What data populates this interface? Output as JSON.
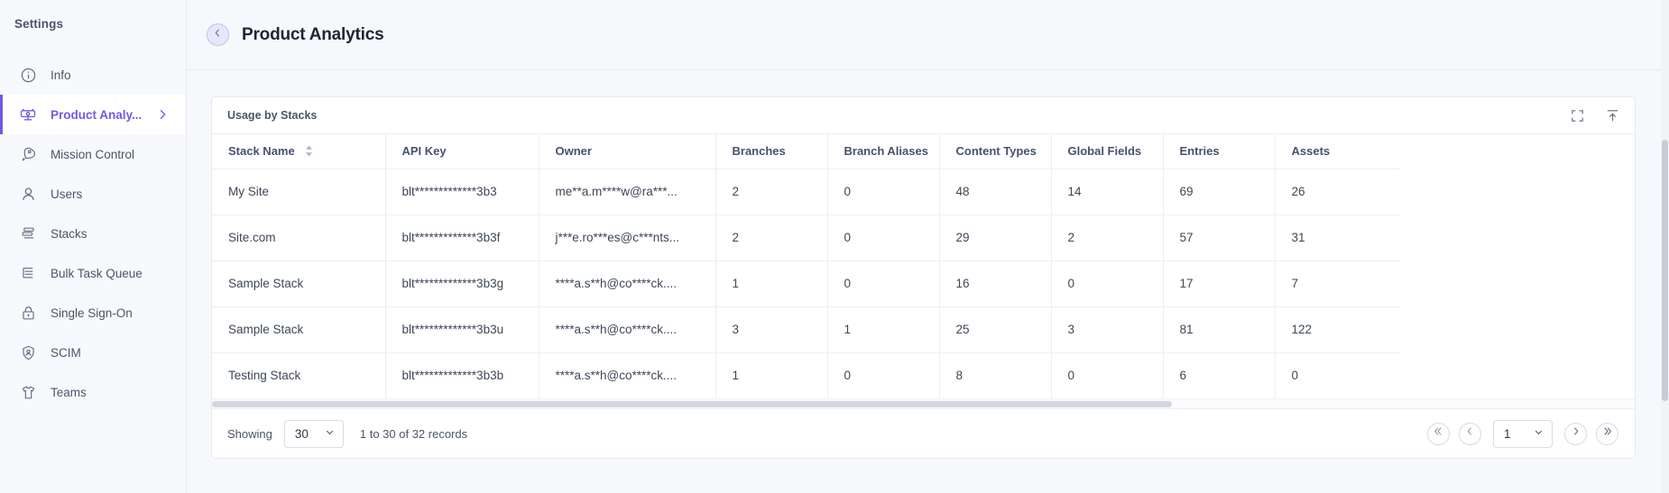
{
  "sidebar": {
    "title": "Settings",
    "items": [
      {
        "label": "Info",
        "icon": "info-circle-icon",
        "active": false
      },
      {
        "label": "Product Analy...",
        "icon": "product-analytics-icon",
        "active": true
      },
      {
        "label": "Mission Control",
        "icon": "rocket-icon",
        "active": false
      },
      {
        "label": "Users",
        "icon": "user-icon",
        "active": false
      },
      {
        "label": "Stacks",
        "icon": "stacks-icon",
        "active": false
      },
      {
        "label": "Bulk Task Queue",
        "icon": "list-lines-icon",
        "active": false
      },
      {
        "label": "Single Sign-On",
        "icon": "lock-icon",
        "active": false
      },
      {
        "label": "SCIM",
        "icon": "shield-user-icon",
        "active": false
      },
      {
        "label": "Teams",
        "icon": "tshirt-icon",
        "active": false
      }
    ]
  },
  "header": {
    "back_icon": "chevron-left-icon",
    "title": "Product Analytics"
  },
  "card": {
    "title": "Usage by Stacks",
    "actions": [
      {
        "name": "expand-icon",
        "label": "Expand"
      },
      {
        "name": "export-icon",
        "label": "Export"
      }
    ]
  },
  "table": {
    "columns": [
      {
        "key": "stack_name",
        "label": "Stack Name",
        "sortable": true
      },
      {
        "key": "api_key",
        "label": "API Key",
        "sortable": false
      },
      {
        "key": "owner",
        "label": "Owner",
        "sortable": false
      },
      {
        "key": "branches",
        "label": "Branches",
        "sortable": false
      },
      {
        "key": "branch_aliases",
        "label": "Branch Aliases",
        "sortable": false
      },
      {
        "key": "content_types",
        "label": "Content Types",
        "sortable": false
      },
      {
        "key": "global_fields",
        "label": "Global Fields",
        "sortable": false
      },
      {
        "key": "entries",
        "label": "Entries",
        "sortable": false
      },
      {
        "key": "assets",
        "label": "Assets",
        "sortable": false
      }
    ],
    "rows": [
      {
        "stack_name": "My Site",
        "api_key": "blt*************3b3",
        "owner": "me**a.m****w@ra***...",
        "branches": "2",
        "branch_aliases": "0",
        "content_types": "48",
        "global_fields": "14",
        "entries": "69",
        "assets": "26"
      },
      {
        "stack_name": "Site.com",
        "api_key": "blt*************3b3f",
        "owner": "j***e.ro***es@c***nts...",
        "branches": "2",
        "branch_aliases": "0",
        "content_types": "29",
        "global_fields": "2",
        "entries": "57",
        "assets": "31"
      },
      {
        "stack_name": "Sample Stack",
        "api_key": "blt*************3b3g",
        "owner": "****a.s**h@co****ck....",
        "branches": "1",
        "branch_aliases": "0",
        "content_types": "16",
        "global_fields": "0",
        "entries": "17",
        "assets": "7"
      },
      {
        "stack_name": "Sample Stack",
        "api_key": "blt*************3b3u",
        "owner": "****a.s**h@co****ck....",
        "branches": "3",
        "branch_aliases": "1",
        "content_types": "25",
        "global_fields": "3",
        "entries": "81",
        "assets": "122"
      },
      {
        "stack_name": "Testing Stack",
        "api_key": "blt*************3b3b",
        "owner": "****a.s**h@co****ck....",
        "branches": "1",
        "branch_aliases": "0",
        "content_types": "8",
        "global_fields": "0",
        "entries": "6",
        "assets": "0"
      }
    ]
  },
  "footer": {
    "showing_label": "Showing",
    "page_size": "30",
    "records_label": "1 to 30 of 32 records",
    "current_page": "1",
    "pager": {
      "first": "first-page-icon",
      "prev": "previous-page-icon",
      "next": "next-page-icon",
      "last": "last-page-icon"
    }
  }
}
